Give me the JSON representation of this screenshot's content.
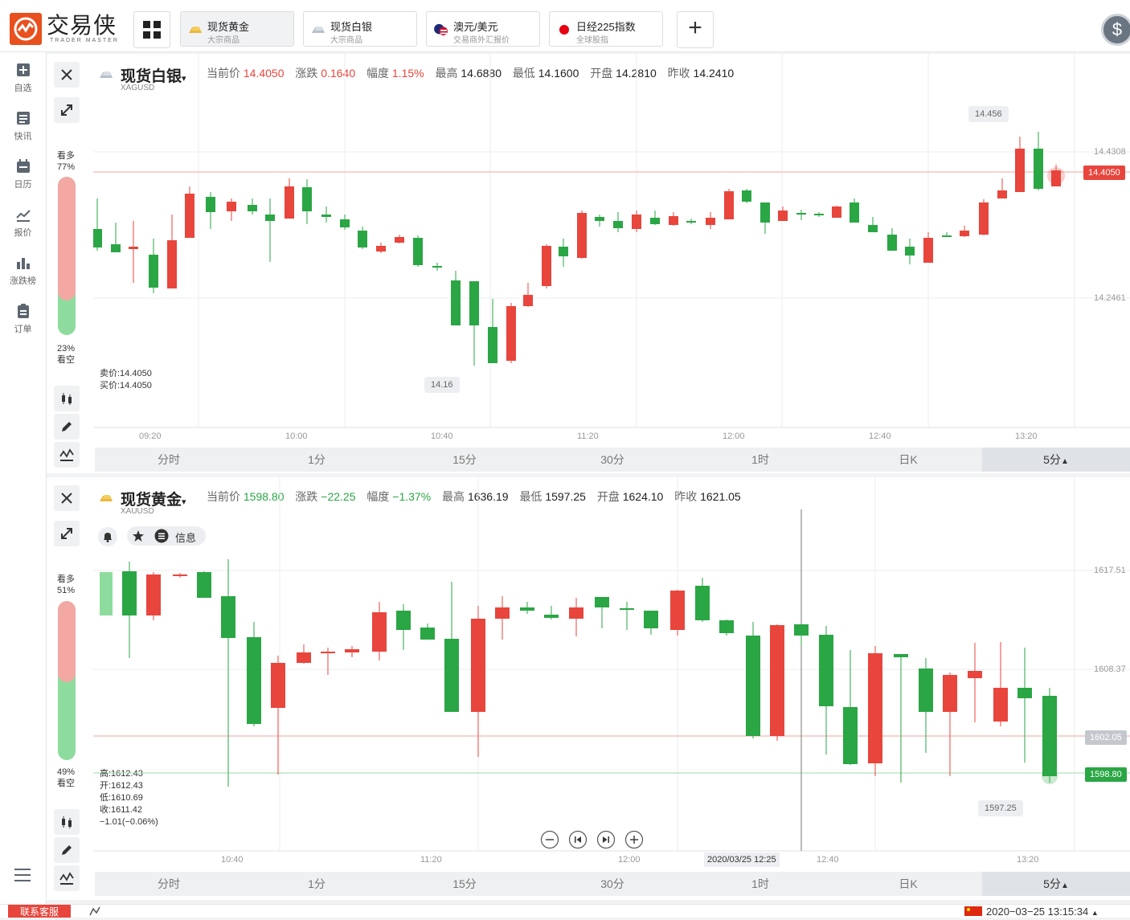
{
  "app": {
    "name": "交易侠",
    "sub": "TRADER MASTER"
  },
  "tabs": [
    {
      "name": "现货黄金",
      "sub": "大宗商品"
    },
    {
      "name": "现货白银",
      "sub": "大宗商品"
    },
    {
      "name": "澳元/美元",
      "sub": "交易商外汇报价"
    },
    {
      "name": "日经225指数",
      "sub": "全球股指"
    }
  ],
  "sidebar": [
    {
      "label": "自选",
      "icon": "plus-square-icon"
    },
    {
      "label": "快讯",
      "icon": "news-list-icon"
    },
    {
      "label": "日历",
      "icon": "calendar-icon"
    },
    {
      "label": "报价",
      "icon": "trend-line-icon"
    },
    {
      "label": "涨跌榜",
      "icon": "bar-rank-icon"
    },
    {
      "label": "订单",
      "icon": "order-clipboard-icon"
    }
  ],
  "periods": [
    "分时",
    "1分",
    "15分",
    "30分",
    "1时",
    "日K",
    "5分"
  ],
  "colors": {
    "up": "#e8453c",
    "down": "#2aa645",
    "accent": "#e8501e"
  },
  "silver": {
    "name": "现货白银",
    "code": "XAGUSD",
    "q_labels": {
      "cur": "当前价",
      "chg": "涨跌",
      "pct": "幅度",
      "high": "最高",
      "low": "最低",
      "open": "开盘",
      "prev": "昨收"
    },
    "cur": "14.4050",
    "chg": "0.1640",
    "pct": "1.15%",
    "high": "14.6880",
    "low": "14.1600",
    "open": "14.2810",
    "prev": "14.2410",
    "bull_label": "看多",
    "bull": "77%",
    "bear": "23%",
    "bear_label": "看空",
    "ask": "卖价:14.4050",
    "bid": "买价:14.4050",
    "price_axis": [
      "14.4308",
      "14.2461"
    ],
    "cur_tag": "14.4050",
    "max_bubble": "14.456",
    "min_bubble": "14.16",
    "time_axis": [
      "09:20",
      "10:00",
      "10:40",
      "11:20",
      "12:00",
      "12:40",
      "13:20"
    ]
  },
  "gold": {
    "name": "现货黄金",
    "code": "XAUUSD",
    "q_labels": {
      "cur": "当前价",
      "chg": "涨跌",
      "pct": "幅度",
      "high": "最高",
      "low": "最低",
      "open": "开盘",
      "prev": "昨收"
    },
    "cur": "1598.80",
    "chg": "−22.25",
    "pct": "−1.37%",
    "high": "1636.19",
    "low": "1597.25",
    "open": "1624.10",
    "prev": "1621.05",
    "bull_label": "看多",
    "bull": "51%",
    "bear": "49%",
    "bear_label": "看空",
    "ohlc": [
      "高:1612.43",
      "开:1612.43",
      "低:1610.69",
      "收:1611.42",
      "−1.01(−0.06%)"
    ],
    "info_label": "信息",
    "price_axis": [
      "1617.51",
      "1608.37"
    ],
    "line_tag": "1602.05",
    "cur_tag": "1598.80",
    "min_bubble": "1597.25",
    "time_axis": [
      "10:40",
      "11:20",
      "12:00",
      "12:40",
      "13:20"
    ],
    "cursor_time": "2020/03/25 12:25"
  },
  "footer": {
    "service": "联系客服",
    "clock": "2020−03−25 13:15:34"
  }
}
